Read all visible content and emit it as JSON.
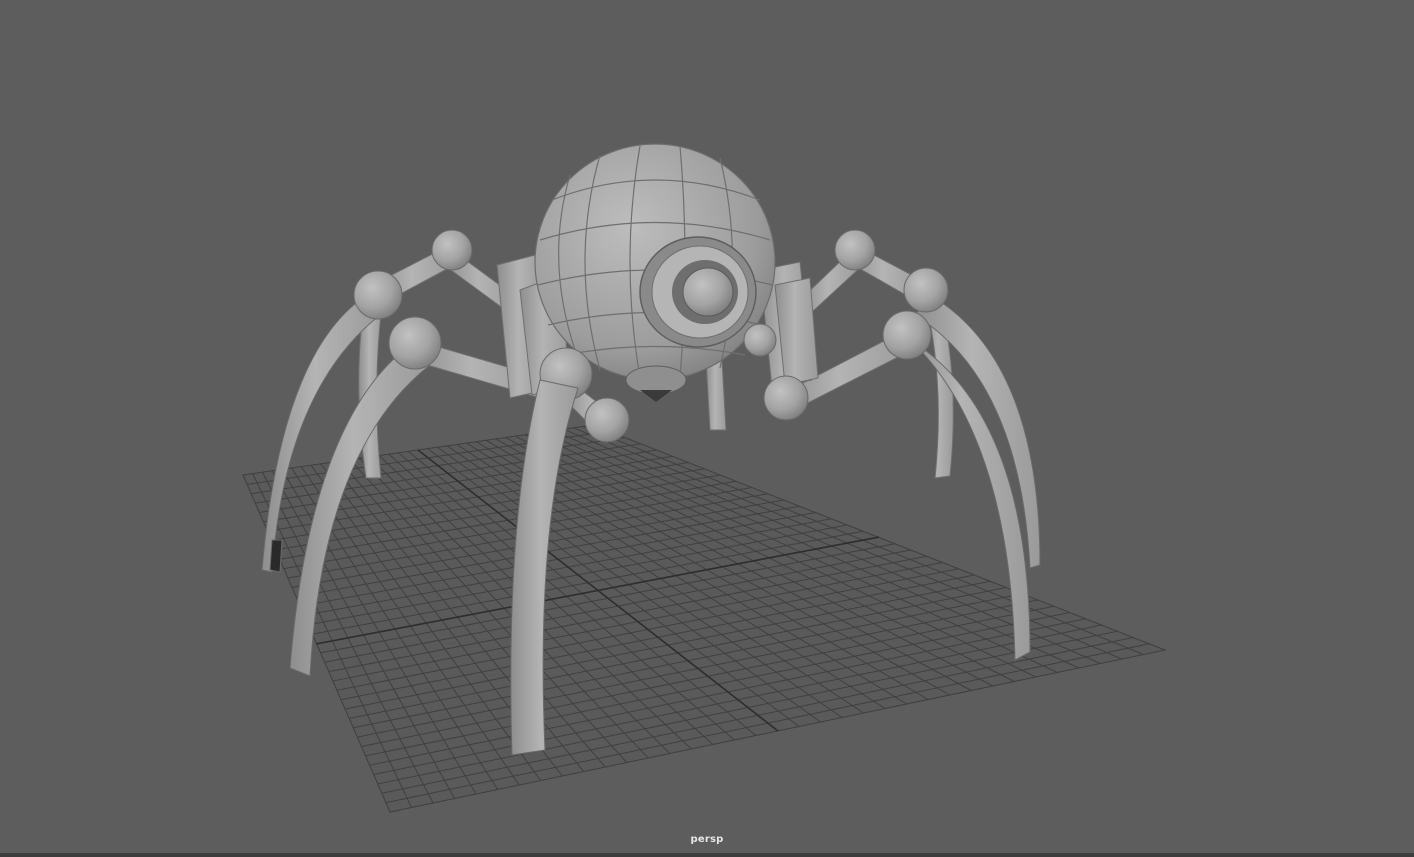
{
  "viewport": {
    "camera_name": "persp",
    "background_color": "#5d5d5d",
    "grid_color": "#3f3f3f",
    "grid_axis_color": "#2e2e2e",
    "model_color": "#a9a9a9"
  },
  "scene": {
    "model_icon": "spider-robot-model",
    "grid_icon": "ground-grid"
  }
}
